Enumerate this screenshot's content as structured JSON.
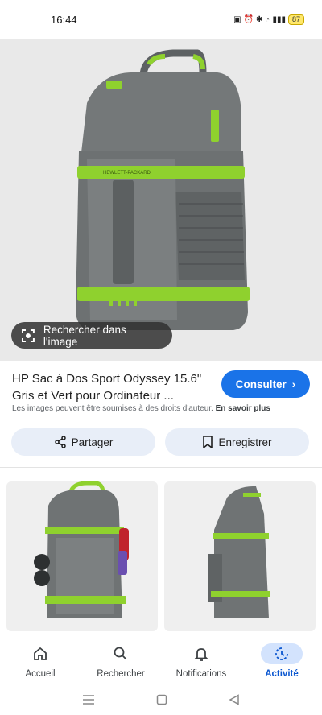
{
  "status_bar": {
    "time": "16:44",
    "battery": "87"
  },
  "hero": {
    "search_chip_label": "Rechercher dans l'image",
    "brand_text": "HEWLETT-PACKARD"
  },
  "product": {
    "title": "HP Sac à Dos Sport Odyssey 15.6\" Gris et Vert pour Ordinateur ...",
    "consult_label": "Consulter",
    "rights_text": "Les images peuvent être soumises à des droits d'auteur.",
    "learn_more": "En savoir plus"
  },
  "actions": {
    "share_label": "Partager",
    "save_label": "Enregistrer"
  },
  "bottom_nav": [
    {
      "label": "Accueil",
      "icon": "home-icon"
    },
    {
      "label": "Rechercher",
      "icon": "search-icon"
    },
    {
      "label": "Notifications",
      "icon": "bell-icon"
    },
    {
      "label": "Activité",
      "icon": "activity-icon",
      "active": true
    }
  ],
  "colors": {
    "accent": "#1a73e8",
    "active_nav": "#0b57d0",
    "backpack_gray": "#6b6f70",
    "backpack_green": "#8fd12e"
  }
}
